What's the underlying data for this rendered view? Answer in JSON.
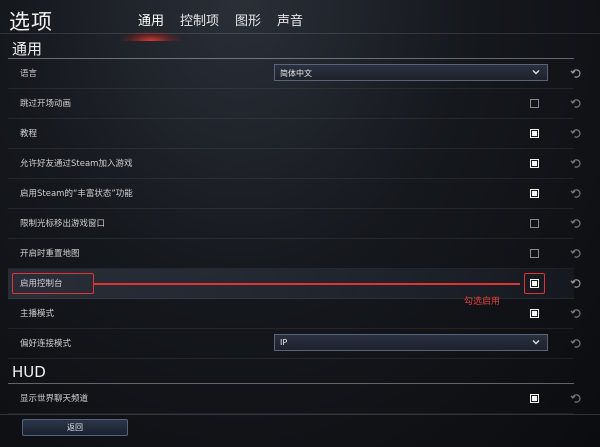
{
  "header": {
    "title": "选项",
    "tabs": [
      {
        "label": "通用",
        "active": true
      },
      {
        "label": "控制项",
        "active": false
      },
      {
        "label": "图形",
        "active": false
      },
      {
        "label": "声音",
        "active": false
      }
    ]
  },
  "sections": {
    "general_title": "通用",
    "hud_title": "HUD"
  },
  "rows": [
    {
      "label": "语言",
      "type": "select",
      "value": "简体中文"
    },
    {
      "label": "跳过开场动画",
      "type": "checkbox",
      "checked": false
    },
    {
      "label": "教程",
      "type": "checkbox",
      "checked": true
    },
    {
      "label": "允许好友通过Steam加入游戏",
      "type": "checkbox",
      "checked": true
    },
    {
      "label": "启用Steam的“丰富状态”功能",
      "type": "checkbox",
      "checked": true
    },
    {
      "label": "限制光标移出游戏窗口",
      "type": "checkbox",
      "checked": false
    },
    {
      "label": "开启时重置地图",
      "type": "checkbox",
      "checked": false
    },
    {
      "label": "启用控制台",
      "type": "checkbox",
      "checked": true
    },
    {
      "label": "主播模式",
      "type": "checkbox",
      "checked": true
    },
    {
      "label": "偏好连接模式",
      "type": "select",
      "value": "IP"
    }
  ],
  "hud_rows": [
    {
      "label": "显示世界聊天频道",
      "type": "checkbox",
      "checked": true
    }
  ],
  "annotation": {
    "text": "勾选启用",
    "color": "#e33232"
  },
  "footer": {
    "back_label": "返回"
  }
}
